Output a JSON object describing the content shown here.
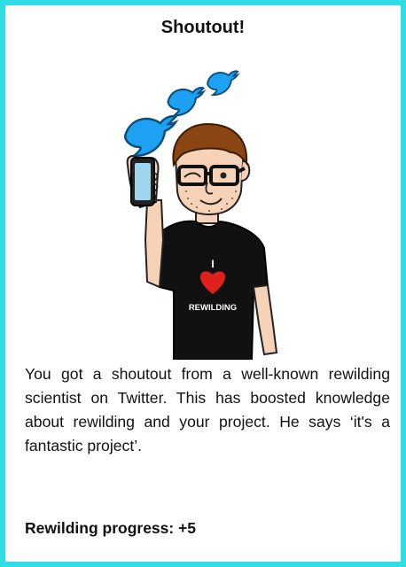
{
  "card": {
    "title": "Shoutout!",
    "description": "You got a shoutout from a well-known rewilding scientist on Twitter. This has boosted knowledge about rewilding and your project. He says ‘it's a fantastic project’.",
    "progress_label": "Rewilding progress: +5",
    "shirt_text_line1": "I",
    "shirt_text_line2": "REWILDING",
    "colors": {
      "border": "#2fdde6",
      "bird": "#1da1f2",
      "shirt": "#111111",
      "skin": "#f6d3b8",
      "hair": "#8b4513",
      "heart": "#e0201c"
    },
    "icons": [
      "twitter-bird-icon",
      "heart-icon",
      "phone-icon"
    ]
  }
}
